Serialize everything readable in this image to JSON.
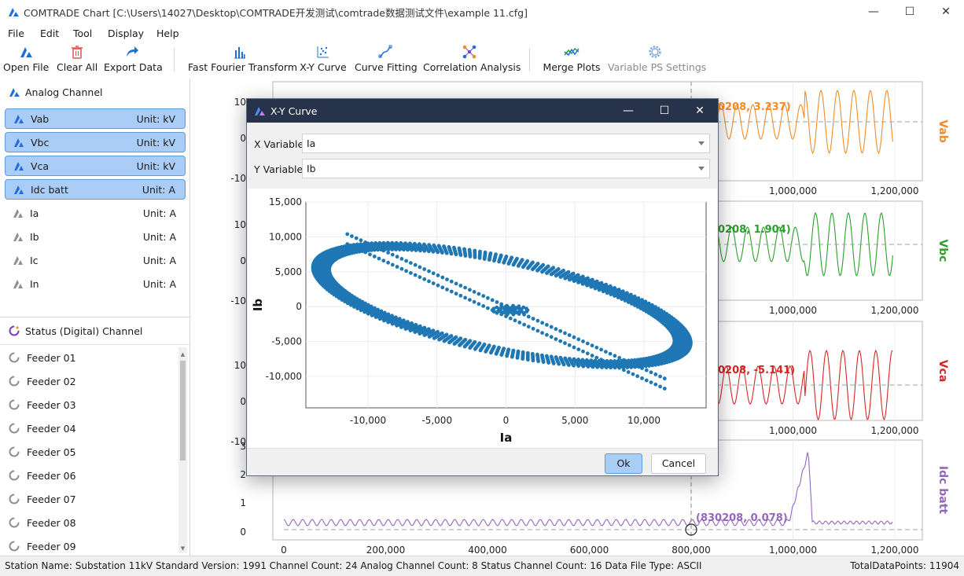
{
  "window": {
    "title": "COMTRADE Chart [C:\\Users\\14027\\Desktop\\COMTRADE开发测试\\comtrade数据测试文件\\example 11.cfg]",
    "min": "—",
    "max": "☐",
    "close": "✕"
  },
  "menu": [
    "File",
    "Edit",
    "Tool",
    "Display",
    "Help"
  ],
  "toolbar": {
    "open": "Open File",
    "clear": "Clear All",
    "export": "Export Data",
    "fft": "Fast Fourier Transform",
    "xy": "X-Y Curve",
    "fitting": "Curve Fitting",
    "correlation": "Correlation Analysis",
    "merge": "Merge Plots",
    "variable_ps": "Variable PS Settings"
  },
  "analog": {
    "header": "Analog Channel",
    "channels": [
      {
        "name": "Vab",
        "unit": "Unit: kV",
        "selected": true
      },
      {
        "name": "Vbc",
        "unit": "Unit: kV",
        "selected": true
      },
      {
        "name": "Vca",
        "unit": "Unit: kV",
        "selected": true
      },
      {
        "name": "Idc batt",
        "unit": "Unit: A",
        "selected": true
      },
      {
        "name": "Ia",
        "unit": "Unit: A",
        "selected": false
      },
      {
        "name": "Ib",
        "unit": "Unit: A",
        "selected": false
      },
      {
        "name": "Ic",
        "unit": "Unit: A",
        "selected": false
      },
      {
        "name": "In",
        "unit": "Unit: A",
        "selected": false
      }
    ]
  },
  "status": {
    "header": "Status (Digital) Channel",
    "feeders": [
      "Feeder 01",
      "Feeder 02",
      "Feeder 03",
      "Feeder 04",
      "Feeder 05",
      "Feeder 06",
      "Feeder 07",
      "Feeder 08",
      "Feeder 09"
    ]
  },
  "statusbar": {
    "left": "Station Name: Substation 11kV  Standard Version: 1991  Channel Count: 24  Analog Channel Count: 8  Status Channel Count: 16  Data File Type: ASCII",
    "right": "TotalDataPoints: 11904"
  },
  "plots": {
    "x_ticks": [
      "1,000,000",
      "1,200,000"
    ],
    "bottom_x_ticks": [
      "0",
      "200,000",
      "400,000",
      "600,000",
      "800,000",
      "1,000,000",
      "1,200,000"
    ],
    "panels": [
      {
        "label": "Vab",
        "color": "#f28c28",
        "annotation": "0208, 3.237)",
        "y_ticks": [
          "10",
          "0",
          "-10"
        ]
      },
      {
        "label": "Vbc",
        "color": "#2ca02c",
        "annotation": "0208, 1.904)",
        "y_ticks": [
          "10",
          "0",
          "-10"
        ]
      },
      {
        "label": "Vca",
        "color": "#d62728",
        "annotation": "0208, -5.141)",
        "y_ticks": [
          "10",
          "0",
          "-10"
        ]
      },
      {
        "label": "Idc batt",
        "color": "#9467bd",
        "annotation": "(830208, 0.078)",
        "y_ticks": [
          "3",
          "2",
          "1",
          "0"
        ]
      }
    ]
  },
  "dialog": {
    "title": "X-Y Curve",
    "x_label": "X Variable:",
    "x_value": "Ia",
    "y_label": "Y Variable:",
    "y_value": "Ib",
    "ok": "Ok",
    "cancel": "Cancel"
  },
  "chart_data": {
    "type": "scatter",
    "xlabel": "Ia",
    "ylabel": "Ib",
    "xlim": [
      -14500,
      14500
    ],
    "ylim": [
      -14500,
      15000
    ],
    "x_ticks": [
      -10000,
      -5000,
      0,
      5000,
      10000
    ],
    "y_ticks": [
      -10000,
      -5000,
      0,
      5000,
      10000,
      15000
    ],
    "x_tick_labels": [
      "-10,000",
      "-5,000",
      "0",
      "5,000",
      "10,000"
    ],
    "y_tick_labels": [
      "-10,000",
      "-5,000",
      "0",
      "5,000",
      "10,000",
      "15,000"
    ],
    "grid": true,
    "color": "#1f77b4",
    "shapes": [
      {
        "kind": "ellipse",
        "center": [
          -300,
          200
        ],
        "semi_major": 15000,
        "semi_minor": 6500,
        "angle_deg": -27,
        "turns": 6
      },
      {
        "kind": "line",
        "from": [
          -11500,
          9500
        ],
        "to": [
          11500,
          -11200
        ],
        "width": 900
      },
      {
        "kind": "blob",
        "center": [
          300,
          -500
        ],
        "radius": 900
      }
    ]
  }
}
